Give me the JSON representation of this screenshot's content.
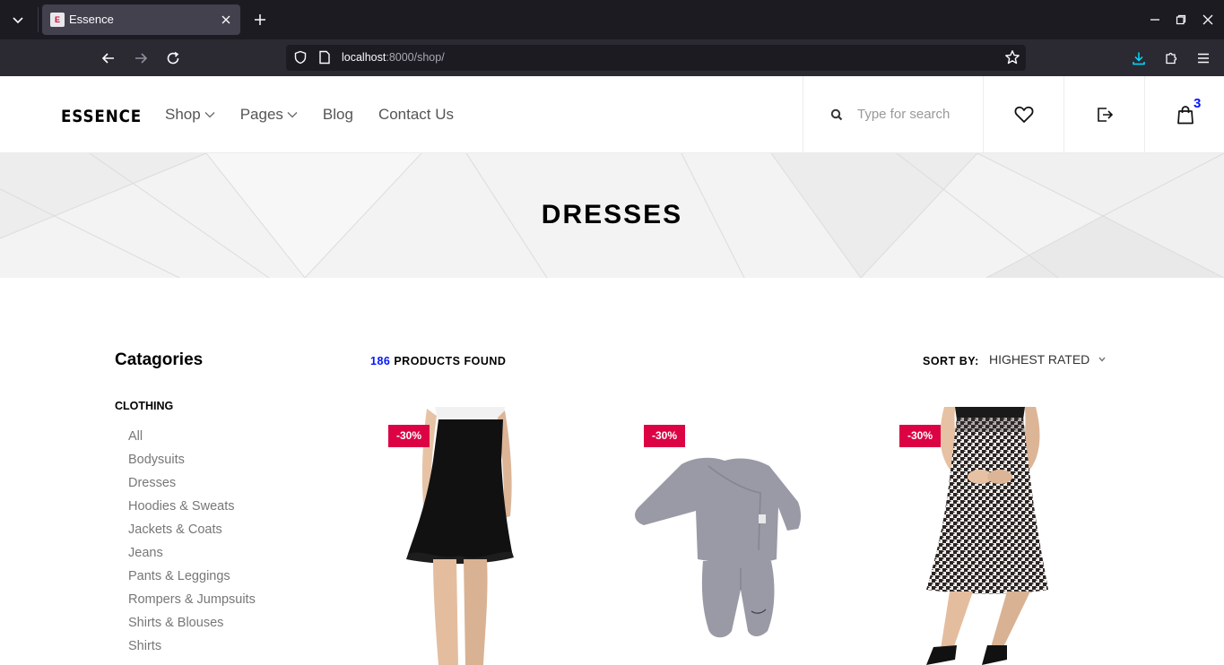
{
  "browser": {
    "tab_title": "Essence",
    "tab_favicon_letter": "E",
    "url_host": "localhost",
    "url_rest": ":8000/shop/"
  },
  "site": {
    "logo": "ESSENCE",
    "menu": [
      {
        "label": "Shop",
        "has_dropdown": true
      },
      {
        "label": "Pages",
        "has_dropdown": true
      },
      {
        "label": "Blog",
        "has_dropdown": false
      },
      {
        "label": "Contact Us",
        "has_dropdown": false
      }
    ],
    "search_placeholder": "Type for search",
    "cart_count": "3"
  },
  "hero": {
    "title": "DRESSES"
  },
  "sidebar": {
    "title": "Catagories",
    "section": "CLOTHING",
    "items": [
      "All",
      "Bodysuits",
      "Dresses",
      "Hoodies & Sweats",
      "Jackets & Coats",
      "Jeans",
      "Pants & Leggings",
      "Rompers & Jumpsuits",
      "Shirts & Blouses",
      "Shirts"
    ]
  },
  "listing": {
    "count": "186",
    "count_suffix": "PRODUCTS FOUND",
    "sort_label": "SORT BY:",
    "sort_value": "HIGHEST RATED"
  },
  "products": [
    {
      "badge": "-30%",
      "image": "black-flared-skirt"
    },
    {
      "badge": "-30%",
      "image": "grey-baby-set"
    },
    {
      "badge": "-30%",
      "image": "houndstooth-skirt"
    }
  ],
  "colors": {
    "accent_badge": "#dc0345",
    "count_blue": "#0315ff",
    "browser_dark": "#1c1b22",
    "browser_toolbar": "#2b2a33"
  }
}
